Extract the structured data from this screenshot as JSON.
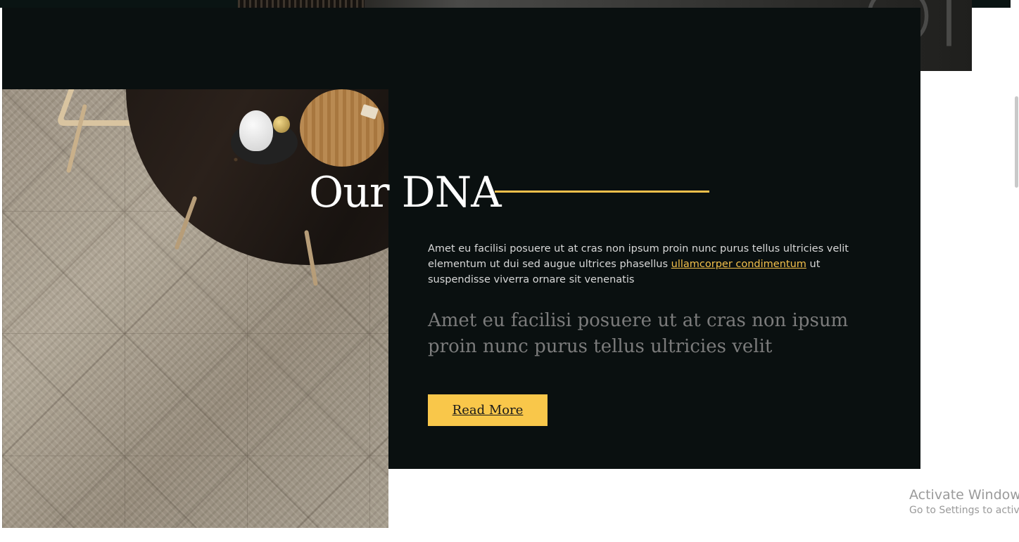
{
  "section": {
    "heading": "Our DNA",
    "body_before_link": "Amet eu facilisi posuere ut at cras non ipsum proin nunc purus tellus ultricies velit elementum ut dui sed augue ultrices phasellus ",
    "body_link": "ullamcorper condimentum",
    "body_after_link": " ut suspendisse viverra ornare sit venenatis",
    "quote": "Amet eu facilisi posuere ut at cras non ipsum proin nunc purus tellus ultricies velit",
    "button_label": "Read More"
  },
  "watermark": {
    "title": "Activate Windows",
    "subtitle": "Go to Settings to activate Windows."
  },
  "colors": {
    "accent": "#f9c74a",
    "section_bg": "#0a1010",
    "link": "#f3c04b"
  },
  "icons": [
    "decorative-photo-image"
  ]
}
